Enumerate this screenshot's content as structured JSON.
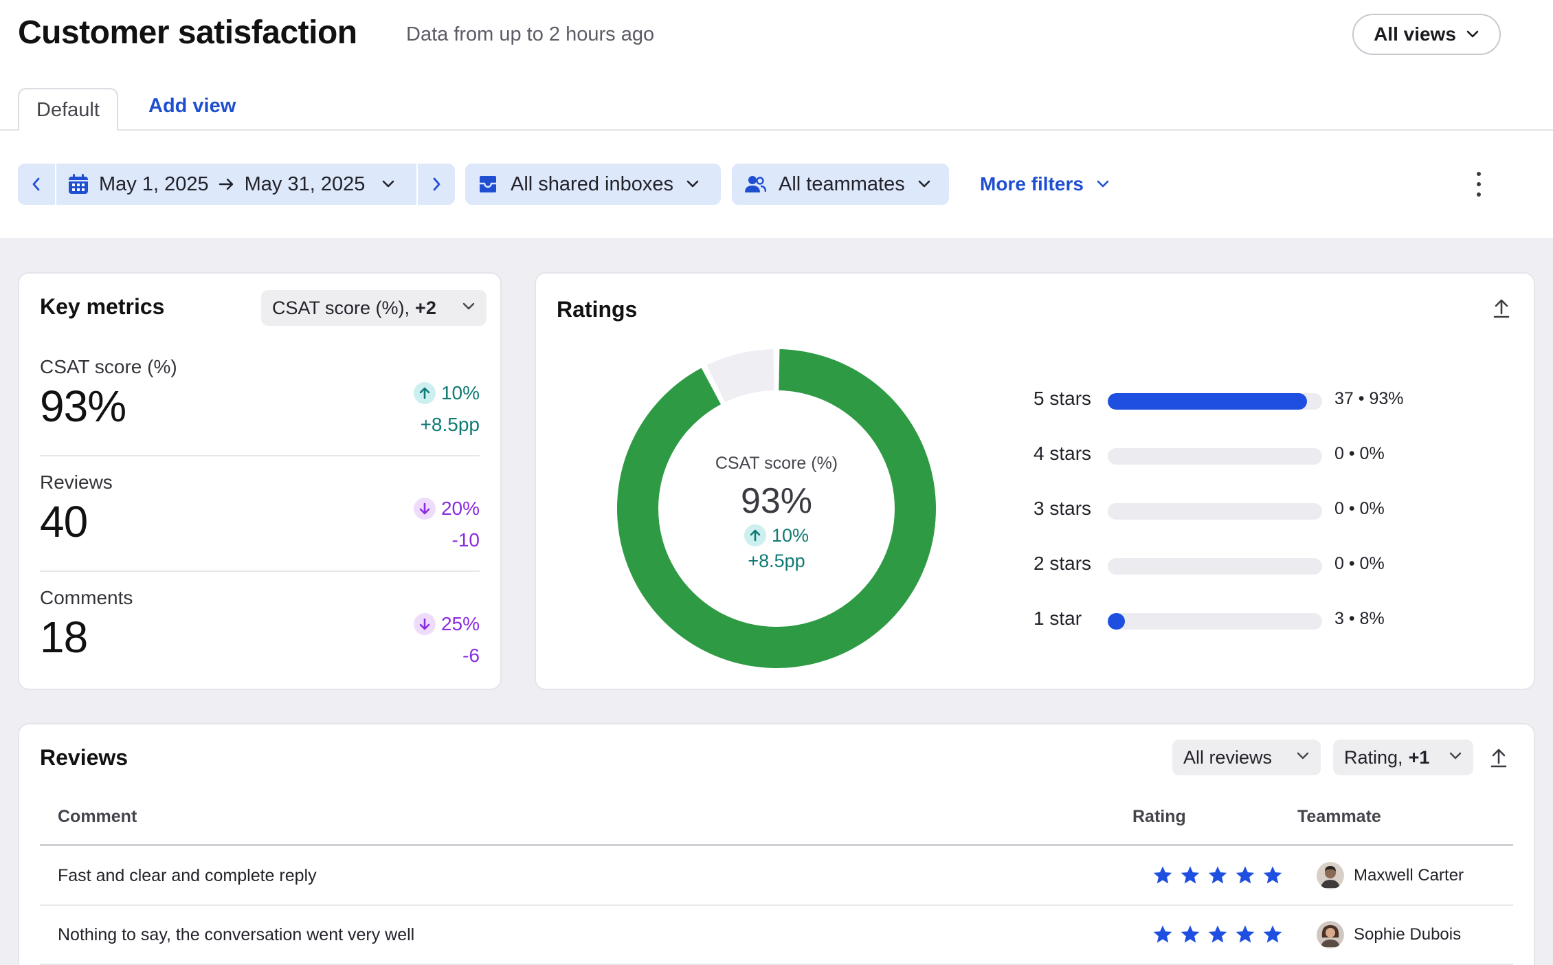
{
  "header": {
    "title": "Customer satisfaction",
    "subtitle": "Data from up to 2 hours ago",
    "views_label": "All views"
  },
  "tabs": [
    {
      "label": "Default",
      "active": true
    },
    {
      "label": "Add view",
      "active": false
    }
  ],
  "filters": {
    "date_start": "May 1, 2025",
    "date_end": "May 31, 2025",
    "inboxes": "All shared inboxes",
    "teammates": "All teammates",
    "more": "More filters"
  },
  "key_metrics": {
    "title": "Key metrics",
    "selector_label": "CSAT score (%),",
    "selector_extra": "+2",
    "metrics": [
      {
        "label": "CSAT score (%)",
        "value": "93%",
        "delta": "10%",
        "abs": "+8.5pp",
        "direction": "up"
      },
      {
        "label": "Reviews",
        "value": "40",
        "delta": "20%",
        "abs": "-10",
        "direction": "down"
      },
      {
        "label": "Comments",
        "value": "18",
        "delta": "25%",
        "abs": "-6",
        "direction": "down"
      }
    ]
  },
  "ratings": {
    "title": "Ratings",
    "donut": {
      "label": "CSAT score (%)",
      "value": "93%",
      "delta": "10%",
      "abs": "+8.5pp",
      "fraction": 0.925,
      "fill_color": "#2e9a44",
      "rest_color": "#efeef3"
    },
    "rows": [
      {
        "label": "5 stars",
        "count": 37,
        "pct": 93,
        "value": "37 • 93%"
      },
      {
        "label": "4 stars",
        "count": 0,
        "pct": 0,
        "value": "0 • 0%"
      },
      {
        "label": "3 stars",
        "count": 0,
        "pct": 0,
        "value": "0 • 0%"
      },
      {
        "label": "2 stars",
        "count": 0,
        "pct": 0,
        "value": "0 • 0%"
      },
      {
        "label": "1 star",
        "count": 3,
        "pct": 8,
        "value": "3 • 8%"
      }
    ]
  },
  "reviews": {
    "title": "Reviews",
    "filter_label": "All reviews",
    "sort_label": "Rating,",
    "sort_extra": "+1",
    "columns": {
      "comment": "Comment",
      "rating": "Rating",
      "teammate": "Teammate"
    },
    "rows": [
      {
        "comment": "Fast and clear and complete reply",
        "stars": 5,
        "teammate": "Maxwell Carter"
      },
      {
        "comment": "Nothing to say, the conversation went very well",
        "stars": 5,
        "teammate": "Sophie Dubois"
      }
    ]
  },
  "colors": {
    "accent": "#1f4fd1",
    "bar": "#1e4fe0",
    "positive": "#0f7a74",
    "negative": "#8a2be2"
  }
}
